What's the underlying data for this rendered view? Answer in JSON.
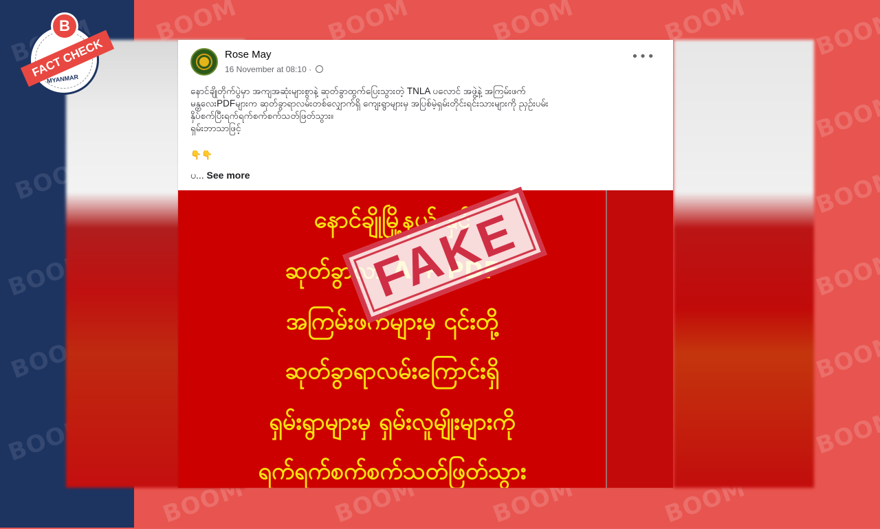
{
  "background": {
    "left_color": "#1d3461",
    "right_color": "#e8544f",
    "watermark_text": "BOOM"
  },
  "logo": {
    "letter": "B",
    "ribbon_text": "FACT CHECK",
    "sub_text": "MYANMAR"
  },
  "post": {
    "author": "Rose May",
    "timestamp": "16 November at 08:10 ·",
    "text_lines": [
      "နောင်ချိုတိုက်ပွဲမှာ  အကျအဆုံးများစွာနဲ့ ဆုတ်ခွာထွက်ပြေးသွားတဲ့ TNLA ပလောင် အဖွဲ့နဲ့ အကြမ်းဖက်",
      "မန္တလေးPDFများက  ဆုတ်ခွာရာလမ်းတစ်လျှောက်ရှိ ကျေးရွာများမှ အပြစ်မဲ့ရှမ်းတိုင်းရင်းသားများကို ညှဉ်းပမ်း",
      "နှိပ်စက်ပြီးရက်ရက်စက်စက်သတ်ဖြတ်သွား။",
      "ရှမ်းဘာသာဖြင့်"
    ],
    "emoji": "👇👇",
    "see_more_prefix": "ပ...",
    "see_more_label": "See more"
  },
  "image_text": [
    "နောင်ချိုမြို့နယ်  နှင့်",
    "ဆုတ်ခွာလာ       A + PDF",
    "အကြမ်းဖက်များမှ ၎င်းတို့",
    "ဆုတ်ခွာရာလမ်းကြောင်းရှိ",
    "ရှမ်းရွာများမှ ရှမ်းလူမျိုးများကို",
    "ရက်ရက်စက်စက်သတ်ဖြတ်သွား"
  ],
  "stamp": {
    "label": "FAKE",
    "color": "#d3384a"
  }
}
